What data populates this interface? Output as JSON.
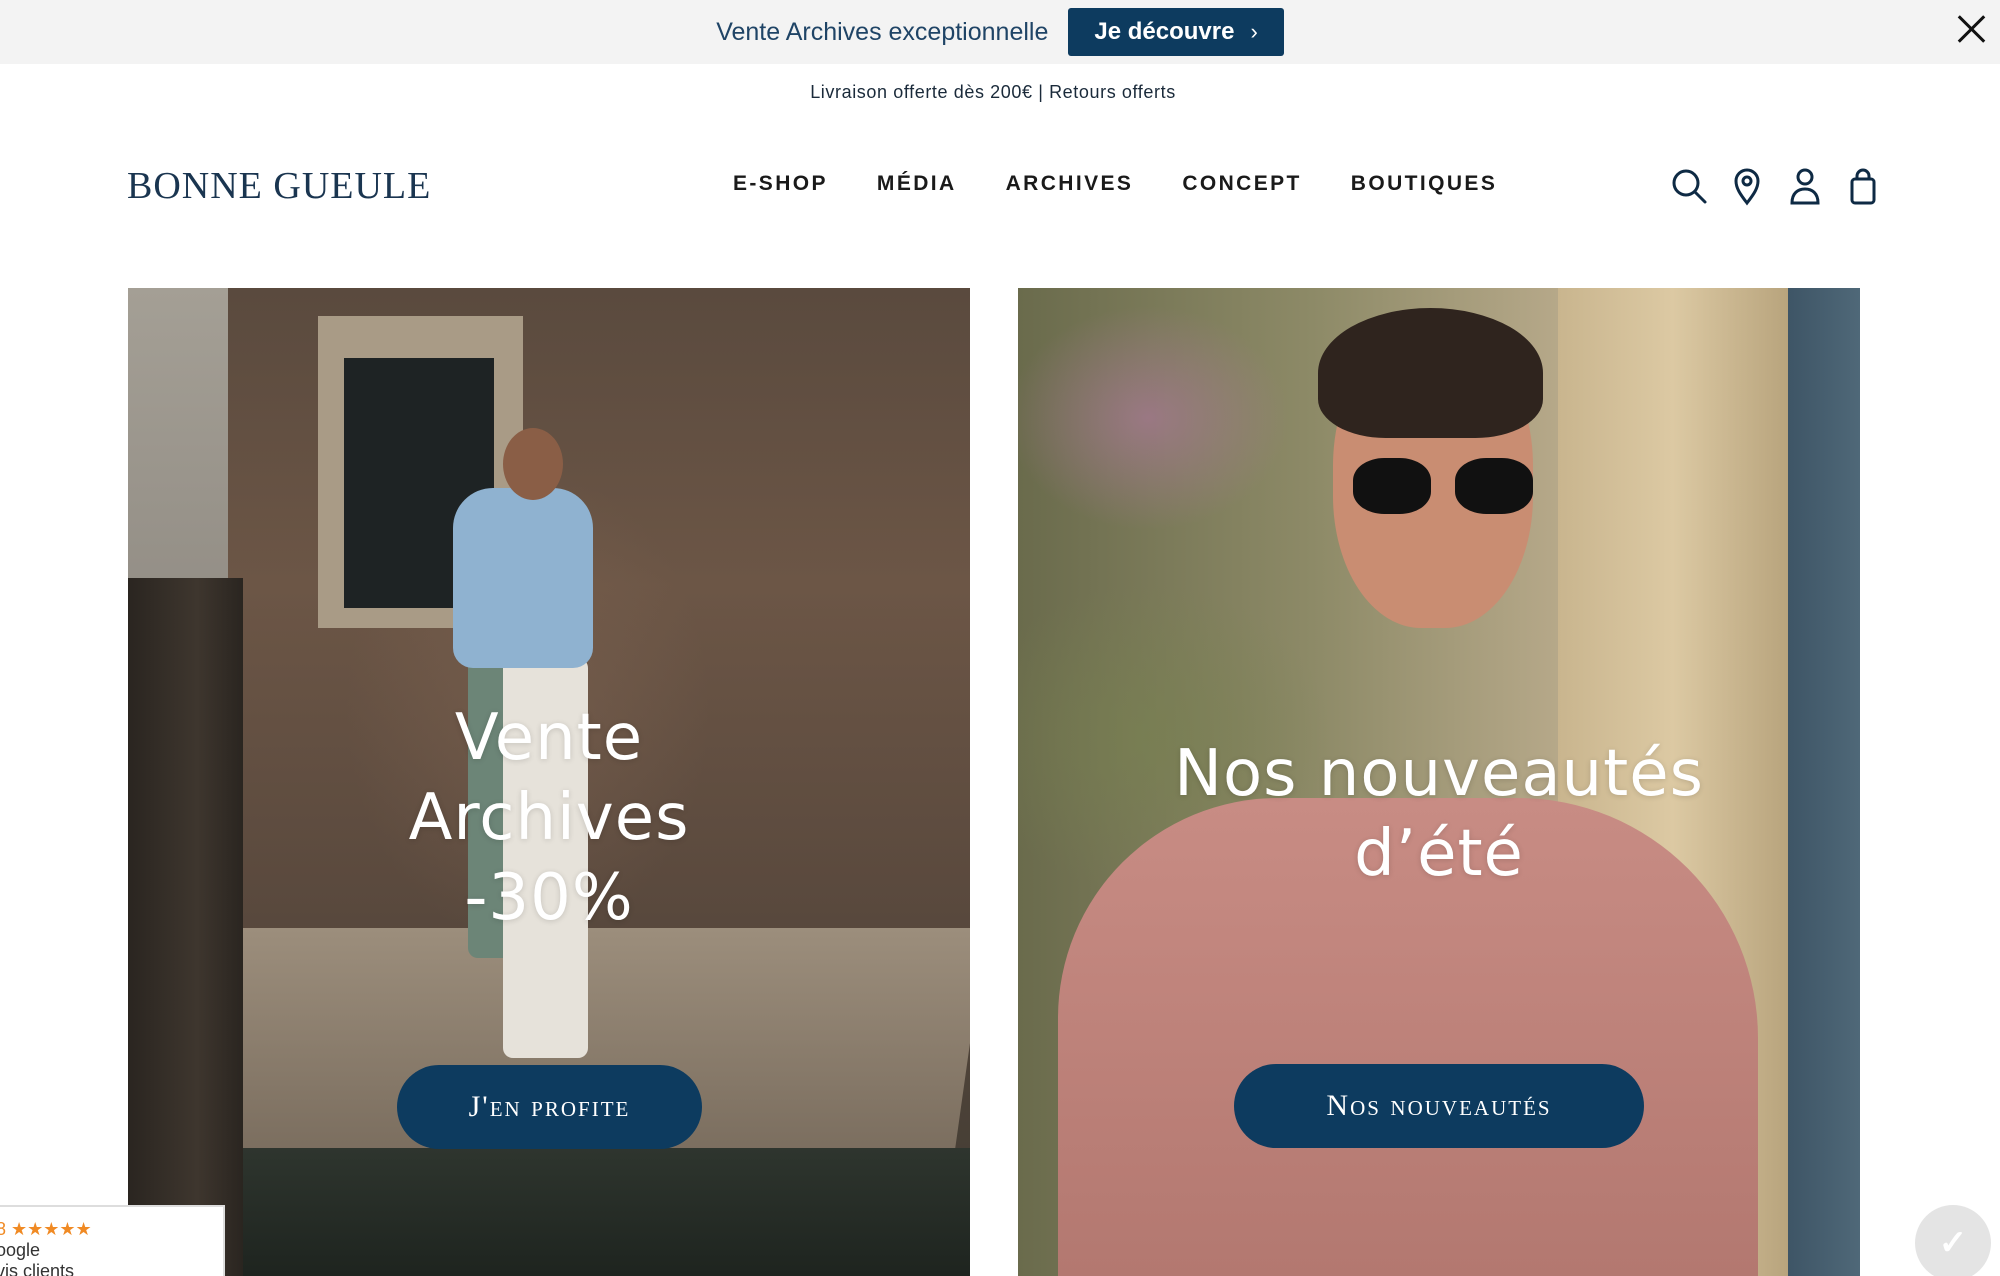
{
  "announcement": {
    "text": "Vente Archives exceptionnelle",
    "cta_label": "Je découvre",
    "cta_icon": "chevron-right-icon",
    "close_icon": "close-icon"
  },
  "shipping_info": "Livraison offerte dès 200€ | Retours offerts",
  "header": {
    "logo": "BONNE GUEULE",
    "nav": [
      "E-SHOP",
      "MÉDIA",
      "ARCHIVES",
      "CONCEPT",
      "BOUTIQUES"
    ],
    "icons": [
      "search-icon",
      "location-pin-icon",
      "account-icon",
      "cart-icon"
    ]
  },
  "hero": {
    "left": {
      "headline_lines": [
        "Vente",
        "Archives",
        "-30%"
      ],
      "button_label": "J'en profite"
    },
    "right": {
      "headline_lines": [
        "Nos nouveautés",
        "d’été"
      ],
      "button_label": "Nos nouveautés"
    }
  },
  "reviews_widget": {
    "rating_text": "8 ★★★★★",
    "source": "oogle",
    "label": "vis clients"
  },
  "chat_button_icon": "chat-icon",
  "colors": {
    "brand_navy": "#0d3b5f",
    "topbar_bg": "#f3f3f3",
    "stars": "#f08a24"
  }
}
